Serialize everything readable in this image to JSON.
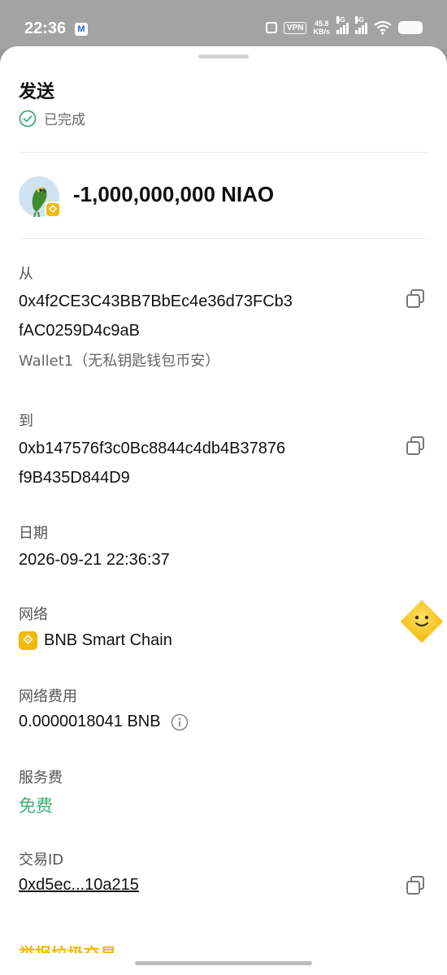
{
  "status_bar": {
    "time": "22:36",
    "vpn": "VPN",
    "speed_value": "45.8",
    "speed_unit": "KB/s",
    "sig1": "5G",
    "sig2": "5G"
  },
  "header": {
    "title": "发送",
    "status": "已完成"
  },
  "token": {
    "amount": "-1,000,000,000 NIAO"
  },
  "from": {
    "label": "从",
    "address_line1": "0x4f2CE3C43BB7BbEc4e36d73FCb3",
    "address_line2": "fAC0259D4c9aB",
    "wallet_name": "Wallet1（无私钥匙钱包币安）"
  },
  "to": {
    "label": "到",
    "address_line1": "0xb147576f3c0Bc8844c4db4B37876",
    "address_line2": "f9B435D844D9"
  },
  "date": {
    "label": "日期",
    "value": "2026-09-21 22:36:37"
  },
  "network": {
    "label": "网络",
    "value": "BNB Smart Chain"
  },
  "network_fee": {
    "label": "网络费用",
    "value": "0.0000018041 BNB"
  },
  "service_fee": {
    "label": "服务费",
    "value": "免费"
  },
  "tx": {
    "label": "交易ID",
    "value": "0xd5ec...10a215"
  },
  "footer": {
    "cut_text": "举报垃圾交易"
  },
  "colors": {
    "success": "#3fae76",
    "bnb": "#f0b90b"
  },
  "icons": [
    "check-circle-icon",
    "copy-icon",
    "info-icon",
    "bnb-icon",
    "parrot-avatar",
    "smiley-float-icon"
  ]
}
